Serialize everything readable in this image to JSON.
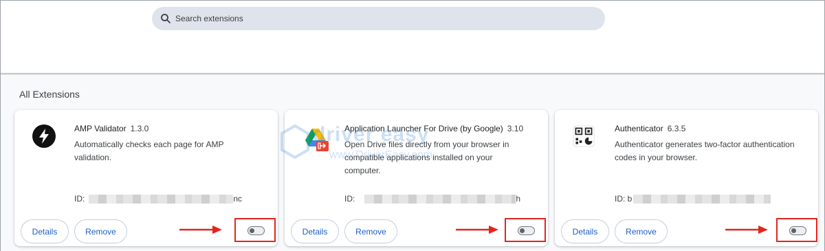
{
  "search": {
    "placeholder": "Search extensions",
    "icon": "search-icon"
  },
  "section_title": "All Extensions",
  "extensions": [
    {
      "name": "AMP Validator",
      "version": "1.3.0",
      "description": "Automatically checks each page for AMP validation.",
      "id_label": "ID:",
      "id_visible": "nc",
      "icon": "lightning-icon",
      "details_label": "Details",
      "remove_label": "Remove",
      "enabled": false
    },
    {
      "name": "Application Launcher For Drive (by Google)",
      "version": "3.10",
      "description": "Open Drive files directly from your browser in compatible applications installed on your computer.",
      "id_label": "ID:",
      "id_visible": "h",
      "icon": "drive-launcher-icon",
      "details_label": "Details",
      "remove_label": "Remove",
      "enabled": false
    },
    {
      "name": "Authenticator",
      "version": "6.3.5",
      "description": "Authenticator generates two-factor authentication codes in your browser.",
      "id_label": "ID: b",
      "id_visible": "",
      "icon": "qr-code-icon",
      "details_label": "Details",
      "remove_label": "Remove",
      "enabled": false
    }
  ],
  "watermark": {
    "text": "driver easy",
    "sub": "www.DriverEasy.com"
  },
  "colors": {
    "accent": "#1a5fc8",
    "highlight": "#e2261c",
    "search_bg": "#dfe3eb"
  }
}
